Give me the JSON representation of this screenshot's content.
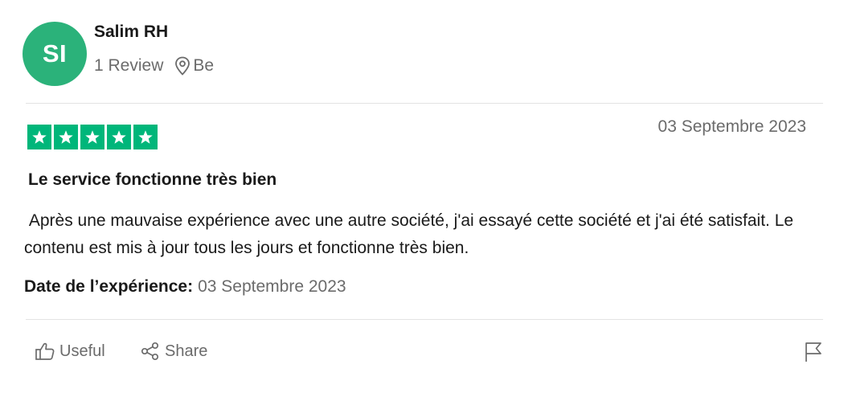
{
  "user": {
    "initials": "SI",
    "name": "Salim RH",
    "review_count": "1 Review",
    "location": "Be",
    "avatar_color": "#2bb27a"
  },
  "review": {
    "rating": 5,
    "max_rating": 5,
    "star_color": "#00b67a",
    "date": "03 Septembre 2023",
    "title": "Le service fonctionne très bien",
    "body": " Après une mauvaise expérience avec une autre société, j'ai essayé cette société et j'ai été satisfait. Le contenu est mis à jour tous les jours et fonctionne très bien.",
    "experience_label": "Date de l’expérience:",
    "experience_date": "03 Septembre 2023"
  },
  "actions": {
    "useful_label": "Useful",
    "share_label": "Share",
    "useful_icon": "thumbs-up-icon",
    "share_icon": "share-icon",
    "flag_icon": "flag-icon"
  }
}
